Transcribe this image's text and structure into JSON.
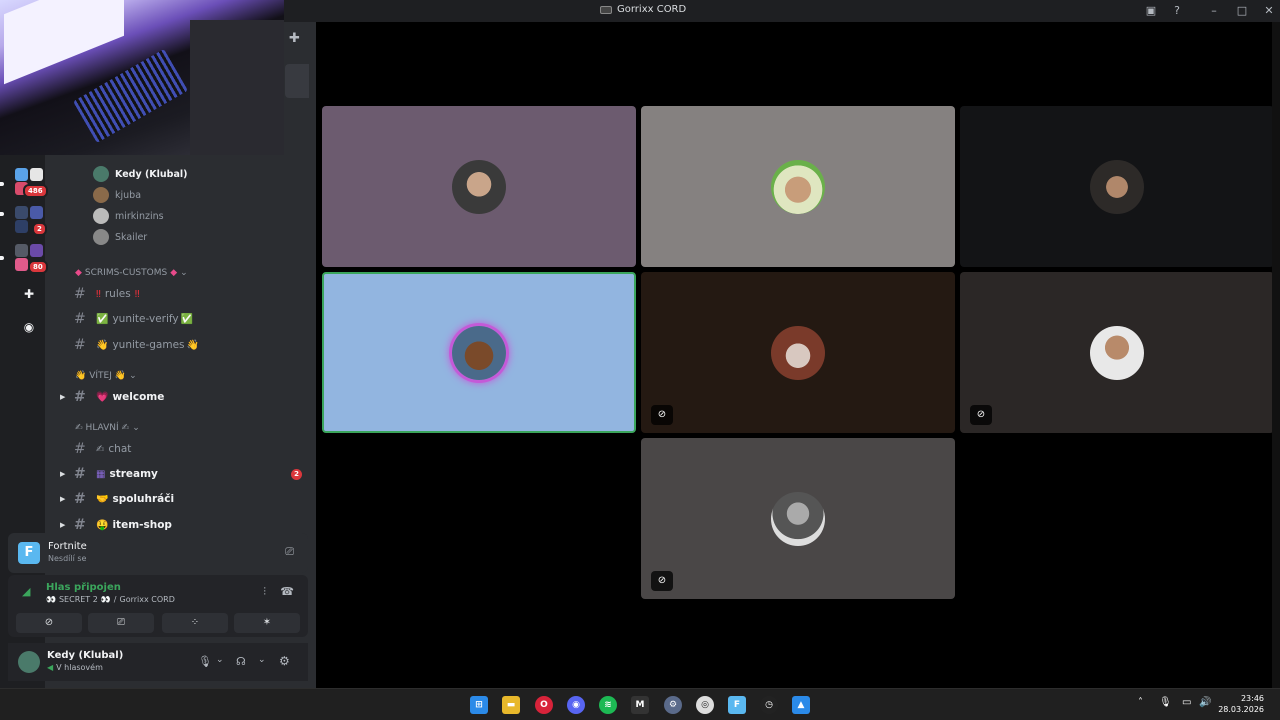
{
  "window": {
    "title": "Gorrixx CORD"
  },
  "servers": [
    {
      "badge": "486",
      "colors": [
        "#5aa2e8",
        "#e6e6e6",
        "#d84b6b"
      ]
    },
    {
      "badge": "2",
      "colors": [
        "#3a4a6b",
        "#4a5aa8",
        "#d84b6b"
      ]
    },
    {
      "badge": "80",
      "colors": [
        "#555a66",
        "#6b4aa8",
        "#e05a8a"
      ]
    }
  ],
  "voice_users": [
    {
      "name": "Kedy (Klubal)",
      "active": true
    },
    {
      "name": "kjuba",
      "active": false
    },
    {
      "name": "mirkinzins",
      "active": false
    },
    {
      "name": "Skailer",
      "active": false
    }
  ],
  "categories": {
    "scrims": "SCRIMS-CUSTOMS",
    "vitej": "VÍTEJ",
    "hlavni": "HLAVNÍ"
  },
  "channels": {
    "rules": "rules",
    "yunite_verify": "yunite-verify",
    "yunite_games": "yunite-games",
    "welcome": "welcome",
    "chat": "chat",
    "streamy": "streamy",
    "streamy_badge": "2",
    "spoluhraci": "spoluhráči",
    "item_shop": "item-shop"
  },
  "activity": {
    "game": "Fortnite",
    "status": "Nesdílí se"
  },
  "voice": {
    "status": "Hlas připojen",
    "channel": "SECRET 2",
    "server": "Gorrixx CORD"
  },
  "user": {
    "name": "Kedy (Klubal)",
    "status": "V hlasovém"
  },
  "taskbar": {
    "time": "23:46",
    "date": "28.03.2026"
  },
  "colors": {
    "tile1": "#6c5b6f",
    "tile2": "#858180",
    "tile3": "#131416",
    "tile4": "#92b5e0",
    "tile5": "#241912",
    "tile6": "#2b2726",
    "tile7": "#4a4747",
    "speaking_border": "#3ba55c",
    "accent_green": "#3ba55c",
    "alert_red": "#da373c"
  }
}
